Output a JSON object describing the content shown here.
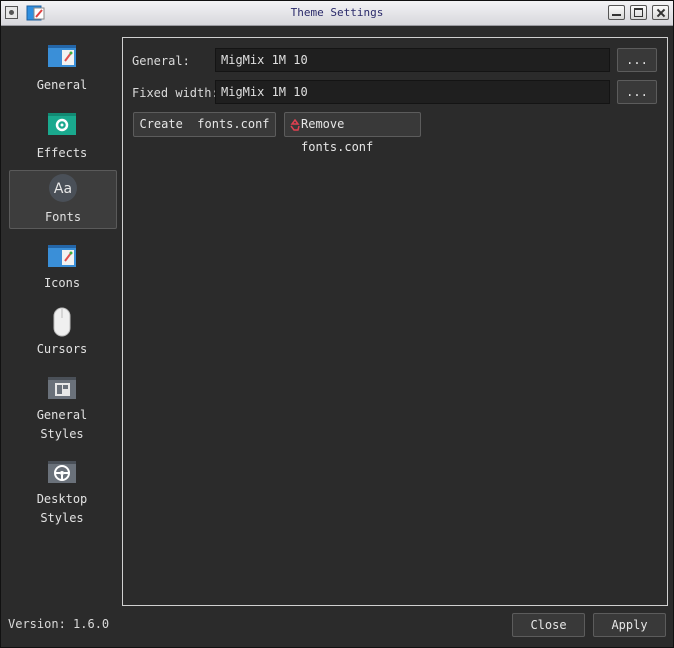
{
  "window": {
    "title": "Theme Settings"
  },
  "sidebar": {
    "items": [
      {
        "label": "General",
        "icon": "window-brush-icon"
      },
      {
        "label": "Effects",
        "icon": "gear-window-icon"
      },
      {
        "label": "Fonts",
        "icon": "font-aa-icon",
        "active": true
      },
      {
        "label": "Icons",
        "icon": "window-brush-icon"
      },
      {
        "label": "Cursors",
        "icon": "mouse-icon"
      },
      {
        "label": "General Styles",
        "line1": "General",
        "line2": "Styles",
        "icon": "layout-window-icon"
      },
      {
        "label": "Desktop Styles",
        "line1": "Desktop",
        "line2": "Styles",
        "icon": "steering-wheel-icon"
      }
    ]
  },
  "fonts": {
    "general_label": "General:",
    "general_value": "MigMix 1M 10",
    "fixed_label": "Fixed width:",
    "fixed_value": "MigMix 1M 10",
    "browse_label": "...",
    "create_label": "Create  fonts.conf",
    "remove_label": "Remove fonts.conf"
  },
  "footer": {
    "version": "Version: 1.6.0",
    "close_label": "Close",
    "apply_label": "Apply"
  },
  "colors": {
    "background": "#2b2b2b",
    "accent_teal": "#1aa98e",
    "accent_blue": "#3a8fd8",
    "remove_icon": "#e04050"
  }
}
